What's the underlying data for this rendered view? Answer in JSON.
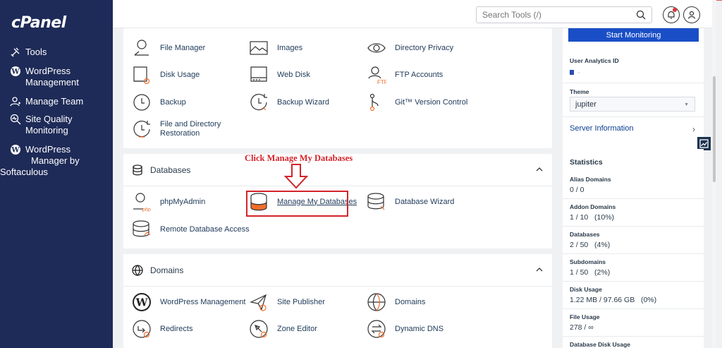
{
  "sidebar": {
    "logo": "cPanel",
    "items": [
      {
        "label": "Tools",
        "icon": "tools-icon"
      },
      {
        "label_lines": [
          "WordPress",
          "Management"
        ],
        "icon": "wordpress-icon"
      },
      {
        "label": "Manage Team",
        "icon": "team-icon"
      },
      {
        "label_lines": [
          "Site Quality",
          "Monitoring"
        ],
        "icon": "monitoring-icon"
      },
      {
        "label_lines": [
          "WordPress",
          "Manager by",
          "Softaculous"
        ],
        "icon": "wordpress-icon"
      }
    ]
  },
  "topbar": {
    "search_placeholder": "Search Tools (/)"
  },
  "files_section": {
    "items": [
      {
        "label": "File Manager",
        "icon": "file-manager-icon"
      },
      {
        "label": "Images",
        "icon": "images-icon"
      },
      {
        "label": "Directory Privacy",
        "icon": "eye-icon"
      },
      {
        "label": "Disk Usage",
        "icon": "disk-usage-icon"
      },
      {
        "label": "Web Disk",
        "icon": "web-disk-icon"
      },
      {
        "label": "FTP Accounts",
        "icon": "ftp-icon"
      },
      {
        "label": "Backup",
        "icon": "backup-icon"
      },
      {
        "label": "Backup Wizard",
        "icon": "backup-wizard-icon"
      },
      {
        "label": "Git™ Version Control",
        "icon": "git-icon"
      },
      {
        "label_lines": [
          "File and Directory",
          "Restoration"
        ],
        "icon": "restore-icon"
      }
    ]
  },
  "databases_section": {
    "title": "Databases",
    "items": [
      {
        "label": "phpMyAdmin",
        "icon": "phpmyadmin-icon"
      },
      {
        "label": "Manage My Databases",
        "icon": "database-icon"
      },
      {
        "label": "Database Wizard",
        "icon": "database-wizard-icon"
      },
      {
        "label": "Remote Database Access",
        "icon": "remote-database-icon"
      }
    ]
  },
  "domains_section": {
    "title": "Domains",
    "items": [
      {
        "label": "WordPress Management",
        "icon": "wordpress-icon"
      },
      {
        "label": "Site Publisher",
        "icon": "site-publisher-icon"
      },
      {
        "label": "Domains",
        "icon": "domains-icon"
      },
      {
        "label": "Redirects",
        "icon": "redirects-icon"
      },
      {
        "label": "Zone Editor",
        "icon": "zone-editor-icon"
      },
      {
        "label": "Dynamic DNS",
        "icon": "dynamic-dns-icon"
      }
    ]
  },
  "annotation": {
    "text": "Click Manage My Databases"
  },
  "right_panel": {
    "start_monitoring": "Start Monitoring",
    "user_analytics_label": "User Analytics ID",
    "theme_label": "Theme",
    "theme_value": "jupiter",
    "server_information": "Server Information",
    "statistics_title": "Statistics",
    "stats": [
      {
        "label": "Alias Domains",
        "value": "0 / 0"
      },
      {
        "label": "Addon Domains",
        "value": "1 / 10   (10%)"
      },
      {
        "label": "Databases",
        "value": "2 / 50   (4%)"
      },
      {
        "label": "Subdomains",
        "value": "1 / 50   (2%)"
      },
      {
        "label": "Disk Usage",
        "value": "1.22 MB / 97.66 GB   (0%)"
      },
      {
        "label": "File Usage",
        "value": "278 / ∞"
      },
      {
        "label": "Database Disk Usage",
        "value": ""
      }
    ]
  },
  "colors": {
    "sidebar_bg": "#1e2b58",
    "accent_blue": "#1a4ec7",
    "annotation_red": "#d3242d",
    "db_orange": "#f26d2b"
  }
}
